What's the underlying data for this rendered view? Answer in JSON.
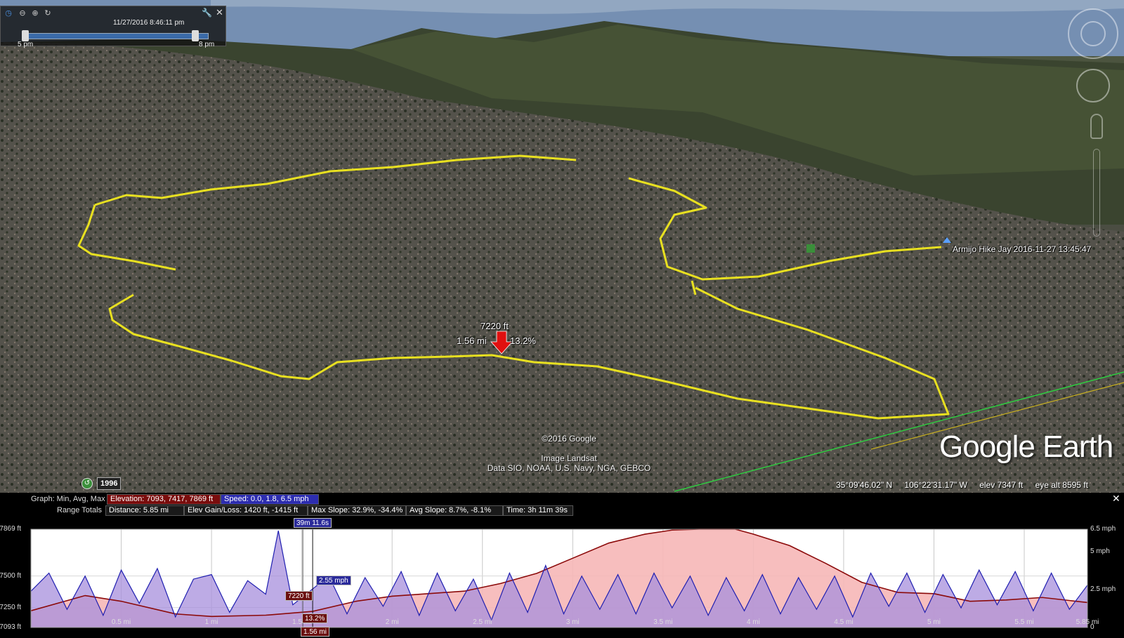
{
  "time_slider": {
    "datetime": "11/27/2016   8:46:11 pm",
    "start_label": "5 pm",
    "end_label": "8 pm",
    "slider_range": [
      0.08,
      0.98
    ]
  },
  "map": {
    "cursor_readout": {
      "elevation": "7220 ft",
      "distance": "1.56 mi",
      "slope": "13.2%"
    },
    "placemark_label": "Armijo Hike Jay 2016-11-27 13:45:47",
    "credits": {
      "copyright": "©2016 Google",
      "imagery": "Image Landsat",
      "data": "Data SIO, NOAA, U.S. Navy, NGA, GEBCO"
    },
    "logo": "Google Earth",
    "historical_year": "1996",
    "status": {
      "lat": "35°09'46.02\" N",
      "lon": "106°22'31.17\" W",
      "elev": "elev  7347 ft",
      "eye_alt": "eye alt   8595 ft"
    },
    "colors": {
      "track": "#e8e020",
      "cursor_arrow": "#e01010"
    }
  },
  "profile": {
    "graph_label": "Graph:  Min, Avg, Max",
    "elevation_summary": "Elevation: 7093, 7417, 7869 ft",
    "speed_summary": "Speed: 0.0, 1.8, 6.5 mph",
    "range_label": "Range Totals",
    "distance": "Distance: 5.85 mi",
    "elev_gain": "Elev Gain/Loss: 1420 ft, -1415 ft",
    "max_slope": "Max Slope: 32.9%, -34.4%",
    "avg_slope": "Avg Slope: 8.7%, -8.1%",
    "time": "Time: 3h 11m 39s",
    "cursor_time": "39m 11.6s",
    "cursor_elev": "7220 ft",
    "cursor_speed": "2.55 mph",
    "cursor_slope": "13.2%",
    "cursor_dist": "1.56 mi",
    "colors": {
      "elevation": "#8b0a0a",
      "elevation_fill": "#f6b7b7",
      "speed": "#1f1fb0",
      "speed_fill": "#a78fdc"
    }
  },
  "chart_data": {
    "type": "line",
    "x_unit": "mi",
    "xlim": [
      0,
      5.85
    ],
    "x_ticks": [
      {
        "v": 0.5,
        "label": "0.5 mi"
      },
      {
        "v": 1,
        "label": "1 mi"
      },
      {
        "v": 1.5,
        "label": "1.5 mi"
      },
      {
        "v": 2,
        "label": "2 mi"
      },
      {
        "v": 2.5,
        "label": "2.5 mi"
      },
      {
        "v": 3,
        "label": "3 mi"
      },
      {
        "v": 3.5,
        "label": "3.5 mi"
      },
      {
        "v": 4,
        "label": "4 mi"
      },
      {
        "v": 4.5,
        "label": "4.5 mi"
      },
      {
        "v": 5,
        "label": "5 mi"
      },
      {
        "v": 5.5,
        "label": "5.5 mi"
      },
      {
        "v": 5.85,
        "label": "5.85 mi"
      }
    ],
    "left_axis": {
      "ylim": [
        7093,
        7869
      ],
      "ticks": [
        {
          "v": 7869,
          "label": "7869 ft"
        },
        {
          "v": 7500,
          "label": "7500 ft"
        },
        {
          "v": 7250,
          "label": "7250 ft"
        },
        {
          "v": 7093,
          "label": "7093 ft"
        }
      ]
    },
    "right_axis": {
      "ylim": [
        0,
        6.5
      ],
      "ticks": [
        {
          "v": 6.5,
          "label": "6.5 mph"
        },
        {
          "v": 5,
          "label": "5 mph"
        },
        {
          "v": 2.5,
          "label": "2.5 mph"
        },
        {
          "v": 0,
          "label": "0"
        }
      ]
    },
    "cursor_x": 1.56,
    "series": [
      {
        "axis": "left",
        "x": [
          0,
          0.3,
          0.5,
          0.8,
          1.0,
          1.3,
          1.56,
          1.8,
          2.0,
          2.2,
          2.4,
          2.6,
          2.8,
          3.0,
          3.2,
          3.4,
          3.55,
          3.7,
          3.9,
          4.0,
          4.2,
          4.4,
          4.6,
          4.8,
          5.0,
          5.2,
          5.4,
          5.6,
          5.85
        ],
        "values": [
          7225,
          7345,
          7300,
          7200,
          7180,
          7190,
          7220,
          7300,
          7340,
          7360,
          7380,
          7440,
          7520,
          7640,
          7760,
          7830,
          7862,
          7869,
          7869,
          7830,
          7740,
          7600,
          7450,
          7370,
          7360,
          7300,
          7310,
          7330,
          7290
        ]
      },
      {
        "axis": "right",
        "x": [
          0,
          0.1,
          0.2,
          0.3,
          0.4,
          0.5,
          0.6,
          0.7,
          0.8,
          0.9,
          1.0,
          1.1,
          1.2,
          1.3,
          1.37,
          1.45,
          1.56,
          1.65,
          1.75,
          1.85,
          1.95,
          2.05,
          2.15,
          2.25,
          2.35,
          2.45,
          2.55,
          2.65,
          2.75,
          2.85,
          2.95,
          3.05,
          3.15,
          3.25,
          3.35,
          3.45,
          3.55,
          3.65,
          3.75,
          3.85,
          3.95,
          4.05,
          4.15,
          4.25,
          4.35,
          4.45,
          4.55,
          4.65,
          4.75,
          4.85,
          4.95,
          5.05,
          5.15,
          5.25,
          5.35,
          5.45,
          5.55,
          5.65,
          5.75,
          5.85
        ],
        "values": [
          2.4,
          3.6,
          1.2,
          3.4,
          0.8,
          3.8,
          1.6,
          3.9,
          0.7,
          3.2,
          3.5,
          1.0,
          3.1,
          2.2,
          6.4,
          1.5,
          2.55,
          3.4,
          0.9,
          3.3,
          1.4,
          3.7,
          0.8,
          3.6,
          1.1,
          3.2,
          0.5,
          3.6,
          1.0,
          4.1,
          0.9,
          3.4,
          1.2,
          3.5,
          0.9,
          3.6,
          1.3,
          3.4,
          0.8,
          3.3,
          1.1,
          3.5,
          0.9,
          3.3,
          1.2,
          3.4,
          0.7,
          3.6,
          1.4,
          3.6,
          1.0,
          3.5,
          1.3,
          3.8,
          1.5,
          3.7,
          1.1,
          3.6,
          1.2,
          2.8
        ]
      }
    ]
  }
}
